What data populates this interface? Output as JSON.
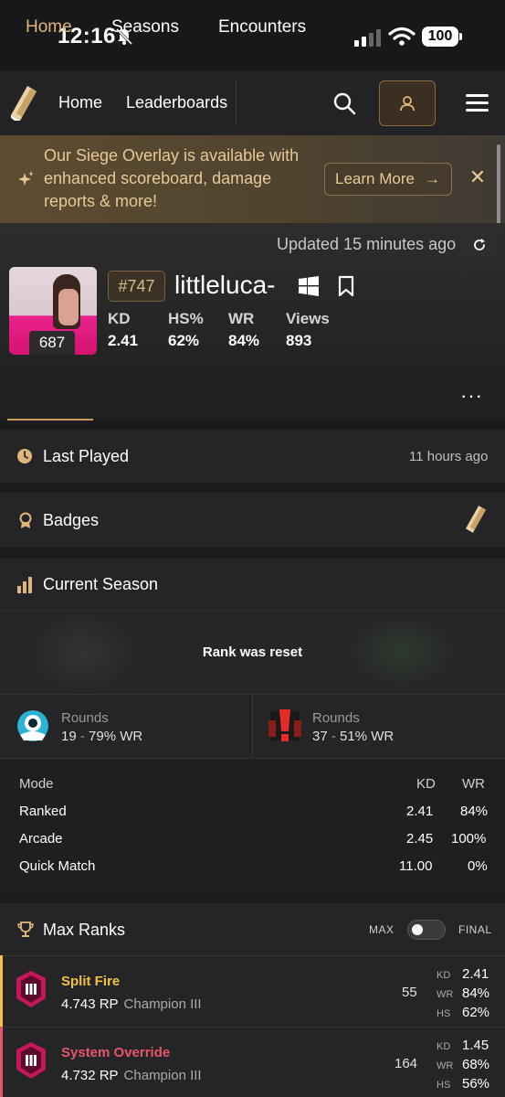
{
  "status_bar": {
    "time": "12:16",
    "battery": "100"
  },
  "nav": {
    "home": "Home",
    "leaderboards": "Leaderboards"
  },
  "banner": {
    "text": "Our Siege Overlay is available with enhanced scoreboard, damage reports & more!",
    "button": "Learn More",
    "arrow": "→",
    "close": "✕"
  },
  "profile": {
    "updated": "Updated 15 minutes ago",
    "level": "687",
    "rank": "#747",
    "username": "littleluca-",
    "stats": [
      {
        "label": "KD",
        "value": "2.41"
      },
      {
        "label": "HS%",
        "value": "62%"
      },
      {
        "label": "WR",
        "value": "84%"
      },
      {
        "label": "Views",
        "value": "893"
      }
    ]
  },
  "tabs": [
    "Home",
    "Seasons",
    "Encounters"
  ],
  "more": "···",
  "last_played": {
    "title": "Last Played",
    "ago": "11 hours ago"
  },
  "badges": {
    "title": "Badges"
  },
  "current_season": {
    "title": "Current Season",
    "status": "Rank was reset",
    "rounds": [
      {
        "label": "Rounds",
        "count": "19",
        "sep": "-",
        "wr": "79% WR",
        "side": "defender"
      },
      {
        "label": "Rounds",
        "count": "37",
        "sep": "-",
        "wr": "51% WR",
        "side": "attacker"
      }
    ],
    "modes": {
      "headers": [
        "Mode",
        "KD",
        "WR"
      ],
      "rows": [
        [
          "Ranked",
          "2.41",
          "84%"
        ],
        [
          "Arcade",
          "2.45",
          "100%"
        ],
        [
          "Quick Match",
          "11.00",
          "0%"
        ]
      ]
    }
  },
  "max_ranks": {
    "title": "Max Ranks",
    "toggle_left": "MAX",
    "toggle_right": "FINAL",
    "rows": [
      {
        "season": "Split Fire",
        "color": "#f0c244",
        "rp": "4.743 RP",
        "tier": "Champion III",
        "matches": "55",
        "kd": "2.41",
        "wr": "84%",
        "hs": "62%"
      },
      {
        "season": "System Override",
        "color": "#e8556b",
        "rp": "4.732 RP",
        "tier": "Champion III",
        "matches": "164",
        "kd": "1.45",
        "wr": "68%",
        "hs": "56%"
      }
    ],
    "labels": {
      "kd": "KD",
      "wr": "WR",
      "hs": "HS"
    }
  },
  "colors": {
    "accent": "#e0b57a",
    "banner_text": "#e7c997"
  }
}
